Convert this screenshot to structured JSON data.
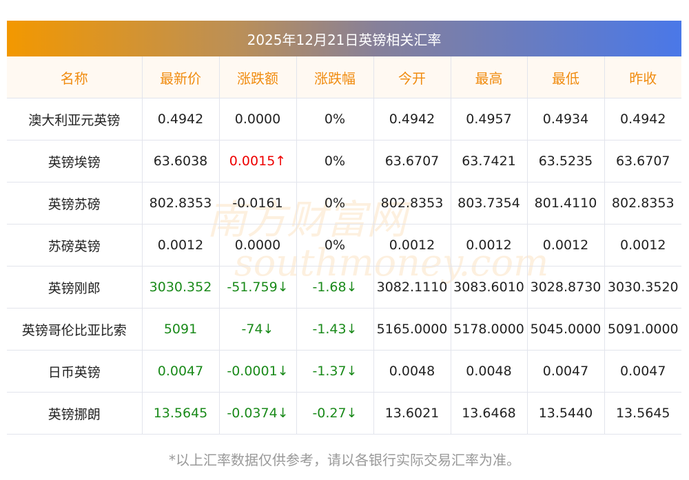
{
  "title": "2025年12月21日英镑相关汇率",
  "headers": [
    "名称",
    "最新价",
    "涨跌额",
    "涨跌幅",
    "今开",
    "最高",
    "最低",
    "昨收"
  ],
  "rows": [
    {
      "name": "澳大利亚元英镑",
      "latest": "0.4942",
      "change": "0.0000",
      "pct": "0%",
      "open": "0.4942",
      "high": "0.4957",
      "low": "0.4934",
      "prev": "0.4942",
      "trend": "flat"
    },
    {
      "name": "英镑埃镑",
      "latest": "63.6038",
      "change": "0.0015↑",
      "pct": "0%",
      "open": "63.6707",
      "high": "63.7421",
      "low": "63.5235",
      "prev": "63.6707",
      "trend": "up"
    },
    {
      "name": "英镑苏磅",
      "latest": "802.8353",
      "change": "-0.0161",
      "pct": "0%",
      "open": "802.8353",
      "high": "803.7354",
      "low": "801.4110",
      "prev": "802.8353",
      "trend": "flat"
    },
    {
      "name": "苏磅英镑",
      "latest": "0.0012",
      "change": "0.0000",
      "pct": "0%",
      "open": "0.0012",
      "high": "0.0012",
      "low": "0.0012",
      "prev": "0.0012",
      "trend": "flat"
    },
    {
      "name": "英镑刚郎",
      "latest": "3030.352",
      "change": "-51.759↓",
      "pct": "-1.68↓",
      "open": "3082.1110",
      "high": "3083.6010",
      "low": "3028.8730",
      "prev": "3030.3520",
      "trend": "down"
    },
    {
      "name": "英镑哥伦比亚比索",
      "latest": "5091",
      "change": "-74↓",
      "pct": "-1.43↓",
      "open": "5165.0000",
      "high": "5178.0000",
      "low": "5045.0000",
      "prev": "5091.0000",
      "trend": "down"
    },
    {
      "name": "日币英镑",
      "latest": "0.0047",
      "change": "-0.0001↓",
      "pct": "-1.37↓",
      "open": "0.0048",
      "high": "0.0048",
      "low": "0.0047",
      "prev": "0.0047",
      "trend": "down"
    },
    {
      "name": "英镑挪朗",
      "latest": "13.5645",
      "change": "-0.0374↓",
      "pct": "-0.27↓",
      "open": "13.6021",
      "high": "13.6468",
      "low": "13.5440",
      "prev": "13.5645",
      "trend": "down"
    }
  ],
  "watermark": {
    "cn": "南方财富网",
    "en": "southmoney.com"
  },
  "footer": "*以上汇率数据仅供参考，请以各银行实际交易汇率为准。"
}
